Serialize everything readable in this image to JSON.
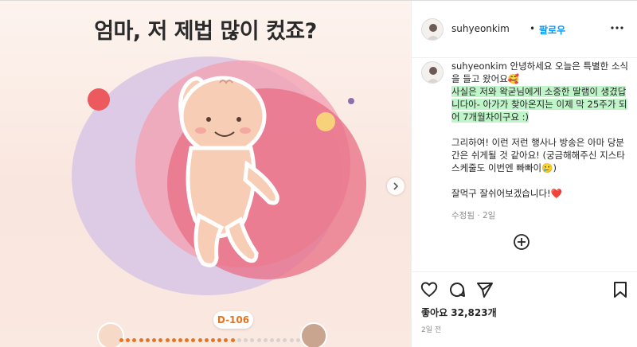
{
  "media": {
    "headline": "엄마, 저 제법 많이 컸죠?",
    "badge": "D-106",
    "colors": {
      "purple_blob": "#d9c7e6",
      "pink_blob": "#f2a6b6",
      "red_blob": "#e86e84",
      "accent_orange": "#e8731f"
    },
    "progress": {
      "total_dots": 28,
      "filled_dots": 18
    }
  },
  "post": {
    "username": "suhyeonkim",
    "separator": "•",
    "follow_label": "팔로우",
    "more_icon": "more-horizontal-icon",
    "caption_user": "suhyeonkim",
    "caption_line1": " 안녕하세요 오늘은 특별한 소식을 들고 왔어요",
    "caption_emoji1": "🥰",
    "caption_highlight": "사실은 저와 왁굳님에게 소중한 딸램이 생겼답니다아- 아가가 찾아온지는 이제 막 25주가 되어 7개월차이구요 :)",
    "caption_para2": "그리하여! 이런 저런 행사나 방송은 아마 당분간은 쉬게될 것 같아요! (궁금해해주신 지스타 스케줄도 이번엔 빠빠이",
    "caption_emoji2": "🥲",
    "caption_para2_end": ")",
    "caption_para3": "잘먹구 잘쉬어보겠습니다!",
    "caption_emoji3": "❤️",
    "meta": "수정됨 · 2일",
    "likes": "좋아요 32,823개",
    "date": "2일 전"
  }
}
